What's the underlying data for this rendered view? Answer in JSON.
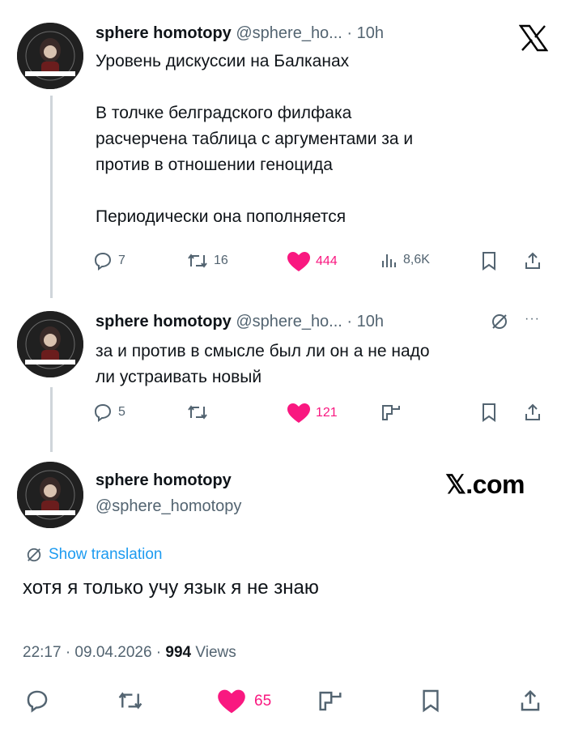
{
  "colors": {
    "like": "#f91880",
    "muted": "#536471",
    "link": "#1d9bf0",
    "thread_line": "#cfd5da"
  },
  "tweet1": {
    "name": "sphere homotopy",
    "handle": "@sphere_ho...",
    "time": "· 10h",
    "line1": "Уровень дискуссии на Балканах",
    "line2": "В толчке белградского филфака",
    "line3": "расчерчена таблица с аргументами за и",
    "line4": "против в отношении геноцида",
    "line5": "Периодически она пополняется",
    "replies": "7",
    "reposts": "16",
    "likes": "444",
    "views": "8,6K"
  },
  "tweet2": {
    "name": "sphere homotopy",
    "handle": "@sphere_ho...",
    "time": "· 10h",
    "line1": "за и против в смысле был ли он а не надо",
    "line2": "ли устраивать новый",
    "replies": "5",
    "likes": "121"
  },
  "tweet3": {
    "name": "sphere homotopy",
    "handle": "@sphere_homotopy",
    "brand": "𝕏.com",
    "translate_label": "Show translation",
    "text": "хотя я только учу язык я не знаю",
    "timestamp": "22:17 · 09.04.2026 · ",
    "views_count": "994",
    "views_label": " Views",
    "likes": "65"
  },
  "icons": [
    "x-logo-icon",
    "reply-icon",
    "repost-icon",
    "like-icon",
    "views-icon",
    "bookmark-icon",
    "share-icon",
    "translate-icon",
    "grok-icon",
    "more-icon"
  ]
}
